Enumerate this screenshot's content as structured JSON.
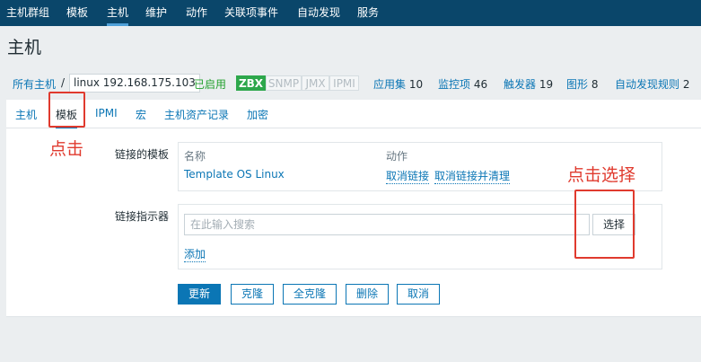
{
  "topnav": {
    "items": [
      "主机群组",
      "模板",
      "主机",
      "维护",
      "动作",
      "关联项事件",
      "自动发现",
      "服务"
    ],
    "active": "主机"
  },
  "page": {
    "title": "主机"
  },
  "breadcrumb": {
    "all_hosts": "所有主机",
    "separator": "/",
    "host": "linux 192.168.175.103",
    "status": "已启用",
    "protocols": [
      "ZBX",
      "SNMP",
      "JMX",
      "IPMI"
    ],
    "links": [
      {
        "label": "应用集",
        "count": "10"
      },
      {
        "label": "监控项",
        "count": "46"
      },
      {
        "label": "触发器",
        "count": "19"
      },
      {
        "label": "图形",
        "count": "8"
      },
      {
        "label": "自动发现规则",
        "count": "2"
      }
    ]
  },
  "tabs": [
    "主机",
    "模板",
    "IPMI",
    "宏",
    "主机资产记录",
    "加密"
  ],
  "active_tab": "模板",
  "form": {
    "linked_templates_label": "链接的模板",
    "col_name": "名称",
    "col_action": "动作",
    "template_name": "Template OS Linux",
    "unlink": "取消链接",
    "unlink_clear": "取消链接并清理",
    "link_indicator_label": "链接指示器",
    "search_placeholder": "在此输入搜索",
    "select_button": "选择",
    "add_link": "添加"
  },
  "buttons": [
    "更新",
    "克隆",
    "全克隆",
    "删除",
    "取消"
  ],
  "annotations": {
    "click": "点击",
    "click_select": "点击选择"
  },
  "colors": {
    "nav_bg": "#0a466a",
    "accent": "#0b76b5",
    "enabled_green": "#23a12e",
    "zbx_green": "#2da74b",
    "annotation_red": "#e03a2e"
  }
}
